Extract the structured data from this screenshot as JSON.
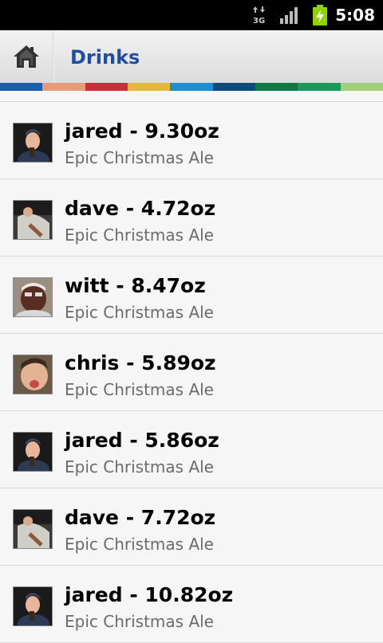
{
  "status_bar": {
    "time": "5:08",
    "network": "3G",
    "network_icon": "network-3g-icon",
    "signal_icon": "signal-icon",
    "battery_icon": "battery-charging-icon",
    "colors": {
      "background": "#000000",
      "battery": "#8fd400"
    }
  },
  "header": {
    "title": "Drinks",
    "home_icon": "home-icon",
    "title_color": "#1e4fa0"
  },
  "stripe_colors": [
    "#1e5ea8",
    "#e8997a",
    "#cf2a3a",
    "#e3b73a",
    "#1b8fd1",
    "#0c4a7a",
    "#0b7a44",
    "#1a9a58",
    "#a3cf7a"
  ],
  "drinks": [
    {
      "user": "jared",
      "amount": "9.30oz",
      "title": "jared - 9.30oz",
      "beer": "Epic Christmas Ale",
      "avatar": "avatar-jared"
    },
    {
      "user": "dave",
      "amount": "4.72oz",
      "title": "dave - 4.72oz",
      "beer": "Epic Christmas Ale",
      "avatar": "avatar-dave"
    },
    {
      "user": "witt",
      "amount": "8.47oz",
      "title": "witt - 8.47oz",
      "beer": "Epic Christmas Ale",
      "avatar": "avatar-witt"
    },
    {
      "user": "chris",
      "amount": "5.89oz",
      "title": "chris - 5.89oz",
      "beer": "Epic Christmas Ale",
      "avatar": "avatar-chris"
    },
    {
      "user": "jared",
      "amount": "5.86oz",
      "title": "jared - 5.86oz",
      "beer": "Epic Christmas Ale",
      "avatar": "avatar-jared"
    },
    {
      "user": "dave",
      "amount": "7.72oz",
      "title": "dave - 7.72oz",
      "beer": "Epic Christmas Ale",
      "avatar": "avatar-dave"
    },
    {
      "user": "jared",
      "amount": "10.82oz",
      "title": "jared - 10.82oz",
      "beer": "Epic Christmas Ale",
      "avatar": "avatar-jared"
    }
  ]
}
